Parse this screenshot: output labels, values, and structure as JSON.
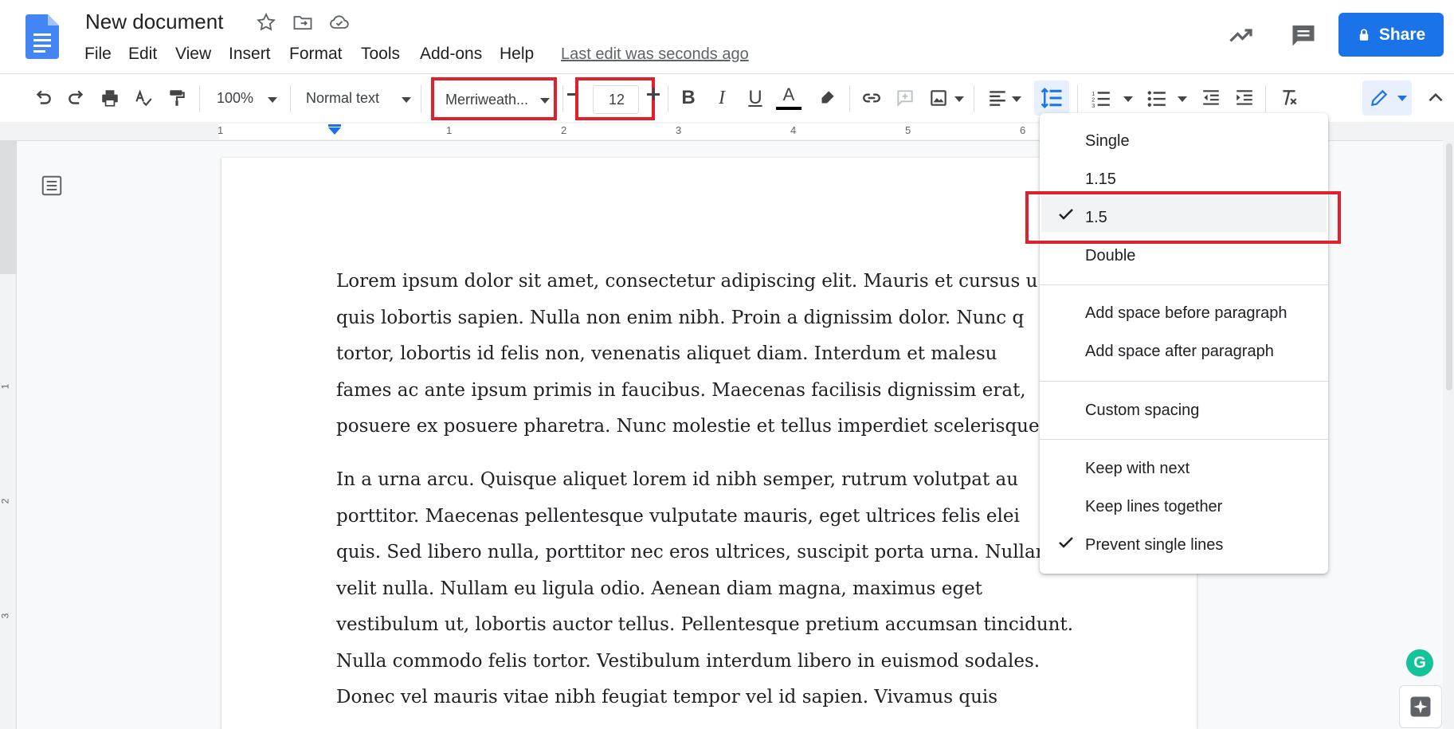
{
  "header": {
    "title": "New document",
    "menu": [
      "File",
      "Edit",
      "View",
      "Insert",
      "Format",
      "Tools",
      "Add-ons",
      "Help"
    ],
    "last_edit": "Last edit was seconds ago",
    "share_label": "Share"
  },
  "toolbar": {
    "zoom": "100%",
    "style": "Normal text",
    "font": "Merriweath...",
    "font_size": "12"
  },
  "ruler": {
    "marks": [
      "1",
      "1",
      "2",
      "3",
      "4",
      "5",
      "6"
    ]
  },
  "vruler": {
    "marks": [
      "1",
      "2",
      "3"
    ]
  },
  "document": {
    "paragraphs": [
      [
        "Lorem ipsum dolor sit amet, consectetur adipiscing elit. Mauris et cursus u",
        "quis lobortis sapien. Nulla non enim nibh. Proin a dignissim dolor. Nunc q",
        "tortor, lobortis id felis non, venenatis aliquet diam. Interdum et malesu",
        "fames ac ante ipsum primis in faucibus. Maecenas facilisis dignissim erat,",
        "posuere ex posuere pharetra. Nunc molestie et tellus imperdiet scelerisque."
      ],
      [
        "In a urna arcu. Quisque aliquet lorem id nibh semper, rutrum volutpat au",
        "porttitor. Maecenas pellentesque vulputate mauris, eget ultrices felis elei",
        "quis. Sed libero nulla, porttitor nec eros ultrices, suscipit porta urna. Nullar",
        "velit nulla. Nullam eu ligula odio. Aenean diam magna, maximus eget",
        "vestibulum ut, lobortis auctor tellus. Pellentesque pretium accumsan tincidunt.",
        "Nulla commodo felis tortor. Vestibulum interdum libero in euismod sodales.",
        "Donec vel mauris vitae nibh feugiat tempor vel id sapien. Vivamus quis"
      ]
    ]
  },
  "line_spacing_menu": {
    "spacing_options": [
      {
        "label": "Single",
        "checked": false
      },
      {
        "label": "1.15",
        "checked": false
      },
      {
        "label": "1.5",
        "checked": true
      },
      {
        "label": "Double",
        "checked": false
      }
    ],
    "paragraph_options": [
      "Add space before paragraph",
      "Add space after paragraph"
    ],
    "custom": "Custom spacing",
    "pagination_options": [
      {
        "label": "Keep with next",
        "checked": false
      },
      {
        "label": "Keep lines together",
        "checked": false
      },
      {
        "label": "Prevent single lines",
        "checked": true
      }
    ]
  },
  "colors": {
    "brand_blue": "#1a73e8",
    "highlight_red": "#e0202a",
    "text_color_bar": "#000000",
    "grammarly_green": "#15c39a"
  }
}
